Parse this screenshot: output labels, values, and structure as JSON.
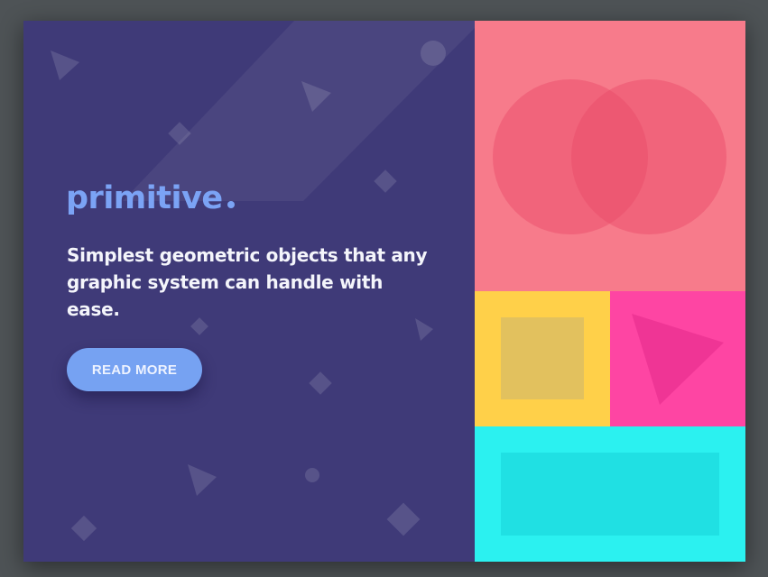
{
  "hero": {
    "brand_name": "primitive",
    "tagline": "Simplest geometric objects that any graphic system can handle with ease.",
    "cta_label": "READ MORE"
  },
  "colors": {
    "left_panel_bg": "#3f3a78",
    "brand_accent": "#7ba3f5",
    "button_bg": "#76a2f2",
    "tile_circles_bg": "#f77b8b",
    "circle_fill": "#e84a68",
    "tile_square_bg": "#ffd049",
    "square_fill": "#e2c15e",
    "tile_triangle_bg": "#fe45a3",
    "triangle_fill": "#ef3595",
    "tile_rect_bg": "#2bf1f0",
    "rect_fill": "#20e0e3"
  },
  "tiles": {
    "circles": {
      "icon": "overlapping-circles-icon"
    },
    "square": {
      "icon": "square-icon"
    },
    "triangle": {
      "icon": "triangle-icon"
    },
    "rectangle": {
      "icon": "rectangle-icon"
    }
  }
}
